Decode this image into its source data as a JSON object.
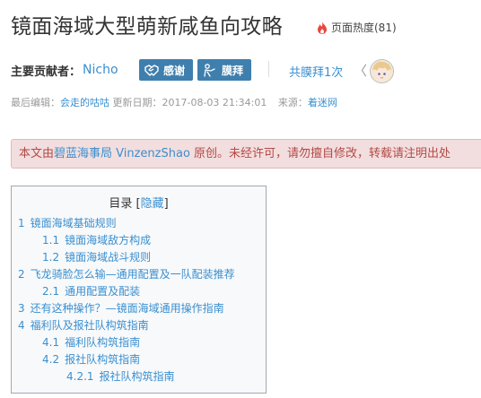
{
  "header": {
    "title": "镜面海域大型萌新咸鱼向攻略",
    "heat_label": "页面热度(81)"
  },
  "contributors": {
    "label": "主要贡献者：",
    "name": "Nicho",
    "thank_button": "感谢",
    "worship_button": "膜拜",
    "worship_count": "共膜拜1次",
    "chevron": "〈"
  },
  "meta": {
    "edited_label": "最后编辑：",
    "editor": "会走的咕咕",
    "date_label": " 更新日期：2017-08-03 21:34:01",
    "source_label": "来源：",
    "source": "着迷网"
  },
  "notice": {
    "prefix": "本文由",
    "link": "碧蓝海事局 VinzenzShao",
    "suffix": " 原创。未经许可，请勿擅自修改，转载请注明出处"
  },
  "toc": {
    "title": "目录",
    "toggle_open": "[",
    "toggle": "隐藏",
    "toggle_close": "]",
    "items": [
      {
        "num": "1",
        "text": "镜面海域基础规则"
      },
      {
        "num": "1.1",
        "text": "镜面海域敌方构成"
      },
      {
        "num": "1.2",
        "text": "镜面海域战斗规则"
      },
      {
        "num": "2",
        "text": "飞龙骑脸怎么输—通用配置及一队配装推荐"
      },
      {
        "num": "2.1",
        "text": "通用配置及配装"
      },
      {
        "num": "3",
        "text": "还有这种操作？—镜面海域通用操作指南"
      },
      {
        "num": "4",
        "text": "福利队及报社队构筑指南"
      },
      {
        "num": "4.1",
        "text": "福利队构筑指南"
      },
      {
        "num": "4.2",
        "text": "报社队构筑指南"
      },
      {
        "num": "4.2.1",
        "text": "报社队构筑指南"
      }
    ]
  },
  "colors": {
    "link": "#3a8fd0",
    "button": "#3f7fae",
    "notice_bg": "#f2dede",
    "notice_text": "#b34a47",
    "flame": "#e8483f"
  }
}
